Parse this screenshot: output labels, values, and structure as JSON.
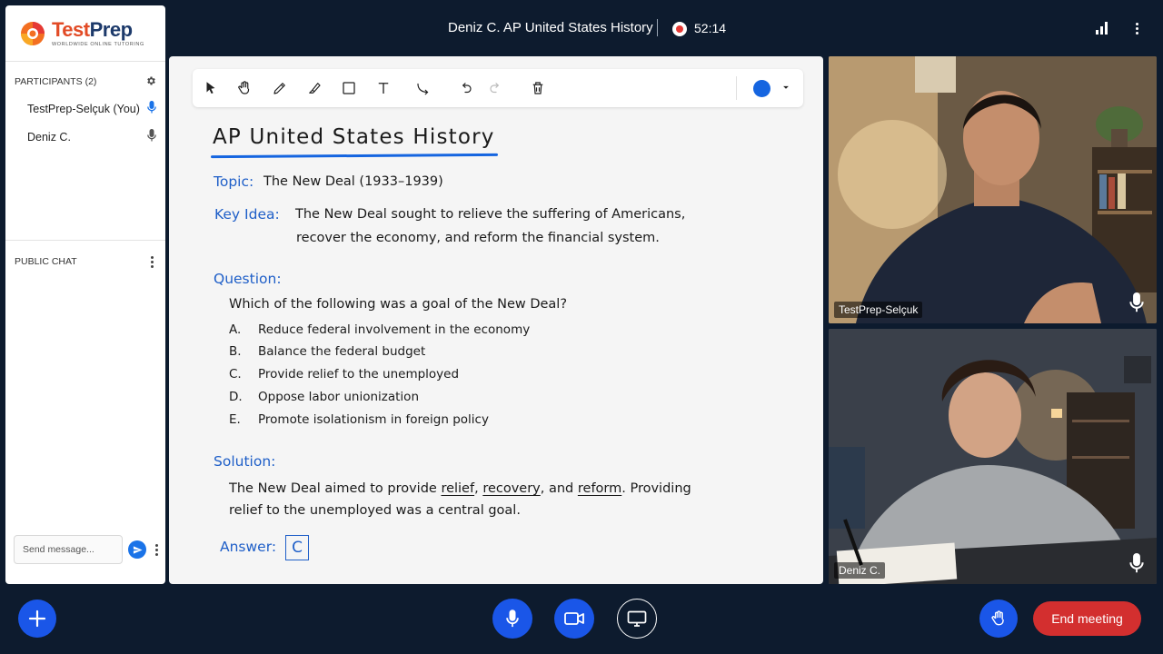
{
  "brand": {
    "name_part1": "Test",
    "name_part2": "Prep",
    "tagline": "WORLDWIDE ONLINE TUTORING"
  },
  "header": {
    "meeting_title": "Deniz C. AP United States History",
    "recording_time": "52:14"
  },
  "sidebar": {
    "participants_heading": "PARTICIPANTS (2)",
    "participants": [
      {
        "name": "TestPrep-Selçuk (You)",
        "mic_active": true
      },
      {
        "name": "Deniz C.",
        "mic_active": false
      }
    ],
    "chat_heading": "PUBLIC CHAT",
    "chat_placeholder": "Send message..."
  },
  "whiteboard": {
    "tools": [
      "pointer-icon",
      "hand-icon",
      "pencil-icon",
      "highlighter-icon",
      "rectangle-icon",
      "text-icon",
      "connector-icon",
      "undo-icon",
      "redo-icon",
      "trash-icon"
    ],
    "selected_color": "#1565e0",
    "title": "AP United States History",
    "topic_label": "Topic:",
    "topic_text": "The New Deal (1933–1939)",
    "key_idea_label": "Key Idea:",
    "key_idea_line1": "The New Deal sought to relieve the suffering of Americans,",
    "key_idea_line2": "recover the economy, and reform the financial system.",
    "question_label": "Question:",
    "question_text": "Which of the following was a goal of the New Deal?",
    "options": [
      {
        "letter": "A.",
        "text": "Reduce federal involvement in the economy"
      },
      {
        "letter": "B.",
        "text": "Balance the federal budget"
      },
      {
        "letter": "C.",
        "text": "Provide relief to the unemployed"
      },
      {
        "letter": "D.",
        "text": "Oppose labor unionization"
      },
      {
        "letter": "E.",
        "text": "Promote isolationism in foreign policy"
      }
    ],
    "solution_label": "Solution:",
    "solution_line1_start": "The New Deal aimed to provide",
    "solution_word_relief": "relief",
    "solution_comma1": ",",
    "solution_word_recovery": "recovery",
    "solution_and": ", and",
    "solution_word_reform": "reform",
    "solution_line1_end": ". Providing",
    "solution_line2": "relief to the unemployed was a central goal.",
    "answer_label": "Answer:",
    "answer_value": "C"
  },
  "videos": [
    {
      "name": "TestPrep-Selçuk"
    },
    {
      "name": "Deniz C."
    }
  ],
  "controls": {
    "end_meeting_label": "End meeting"
  },
  "colors": {
    "accent": "#1a56e8",
    "end": "#d32f2f",
    "background": "#0d1b2e"
  }
}
